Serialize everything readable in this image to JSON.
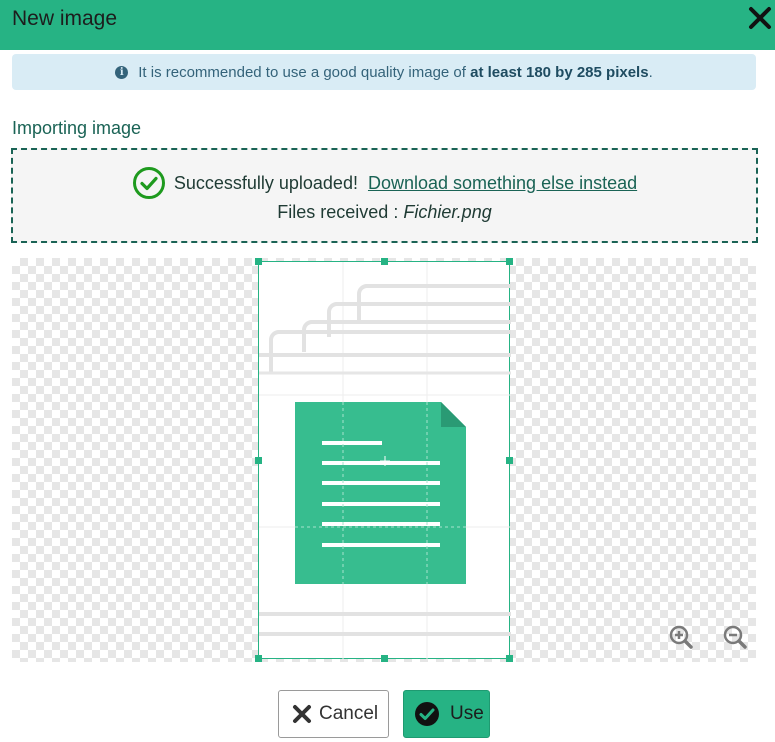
{
  "dialog": {
    "title": "New image",
    "close_icon": "close-icon"
  },
  "info": {
    "icon": "info-icon",
    "text_before": "It is recommended to use a good quality image of",
    "text_bold": "at least 180 by 285 pixels",
    "text_after": "."
  },
  "import": {
    "section_label": "Importing image",
    "success_icon": "check-circle-icon",
    "success_text": "Successfully uploaded!",
    "download_link": "Download something else instead",
    "files_label": "Files received :",
    "file_name": "Fichier.png"
  },
  "editor": {
    "zoom_in_icon": "zoom-in-icon",
    "zoom_out_icon": "zoom-out-icon"
  },
  "actions": {
    "cancel_label": "Cancel",
    "cancel_icon": "x-icon",
    "use_label": "Use",
    "use_icon": "check-circle-icon"
  },
  "colors": {
    "accent": "#26b384",
    "accent_dark": "#1a6355",
    "info_bg": "#d9ecf5"
  }
}
